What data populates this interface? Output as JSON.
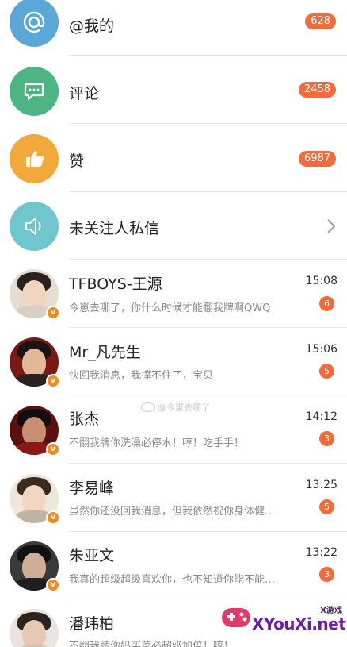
{
  "categories": [
    {
      "label": "@我的",
      "badge": "628",
      "icon": "at-icon",
      "color": "#5aa7d8"
    },
    {
      "label": "评论",
      "badge": "2458",
      "icon": "comment-icon",
      "color": "#4cb582"
    },
    {
      "label": "赞",
      "badge": "6987",
      "icon": "thumbs-up-icon",
      "color": "#f3a83a"
    },
    {
      "label": "未关注人私信",
      "icon": "speaker-icon",
      "color": "#6fc6cf"
    }
  ],
  "conversations": [
    {
      "name": "TFBOYS-王源",
      "time": "15:08",
      "preview": "今崽去哪了，你什么时候才能翻我牌啊QWQ",
      "unread": "6",
      "verified": "v"
    },
    {
      "name": "Mr_凡先生",
      "time": "15:06",
      "preview": "快回我消息，我撑不住了，宝贝",
      "unread": "5",
      "verified": "v"
    },
    {
      "name": "张杰",
      "time": "14:12",
      "preview": "不翻我牌你洗澡必停水！哼！吃手手！",
      "unread": "3",
      "verified": "v"
    },
    {
      "name": "李易峰",
      "time": "13:25",
      "preview": "虽然你还没回我消息，但我依然祝你身体健…",
      "unread": "5",
      "verified": "v"
    },
    {
      "name": "朱亚文",
      "time": "13:22",
      "preview": "我真的超级超级喜欢你，也不知道你能不能…",
      "unread": "3",
      "verified": "v"
    },
    {
      "name": "潘玮柏",
      "time": "",
      "preview": "不翻我牌你妈买菜必超级加倍！哼！",
      "unread": "",
      "verified": "v"
    }
  ],
  "watermark": {
    "text": "@今崽去哪了"
  },
  "logo": {
    "brand": "XYouXi.net",
    "tag": "X游戏"
  }
}
